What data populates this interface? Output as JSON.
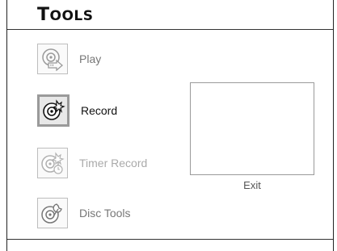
{
  "title": {
    "first": "T",
    "rest": "OOLS"
  },
  "menu": [
    {
      "label": "Play",
      "icon": "disc-play-icon",
      "state": "normal"
    },
    {
      "label": "Record",
      "icon": "disc-record-icon",
      "state": "selected"
    },
    {
      "label": "Timer Record",
      "icon": "disc-timer-record-icon",
      "state": "disabled"
    },
    {
      "label": "Disc Tools",
      "icon": "disc-tools-icon",
      "state": "normal"
    }
  ],
  "exit_label": "Exit"
}
